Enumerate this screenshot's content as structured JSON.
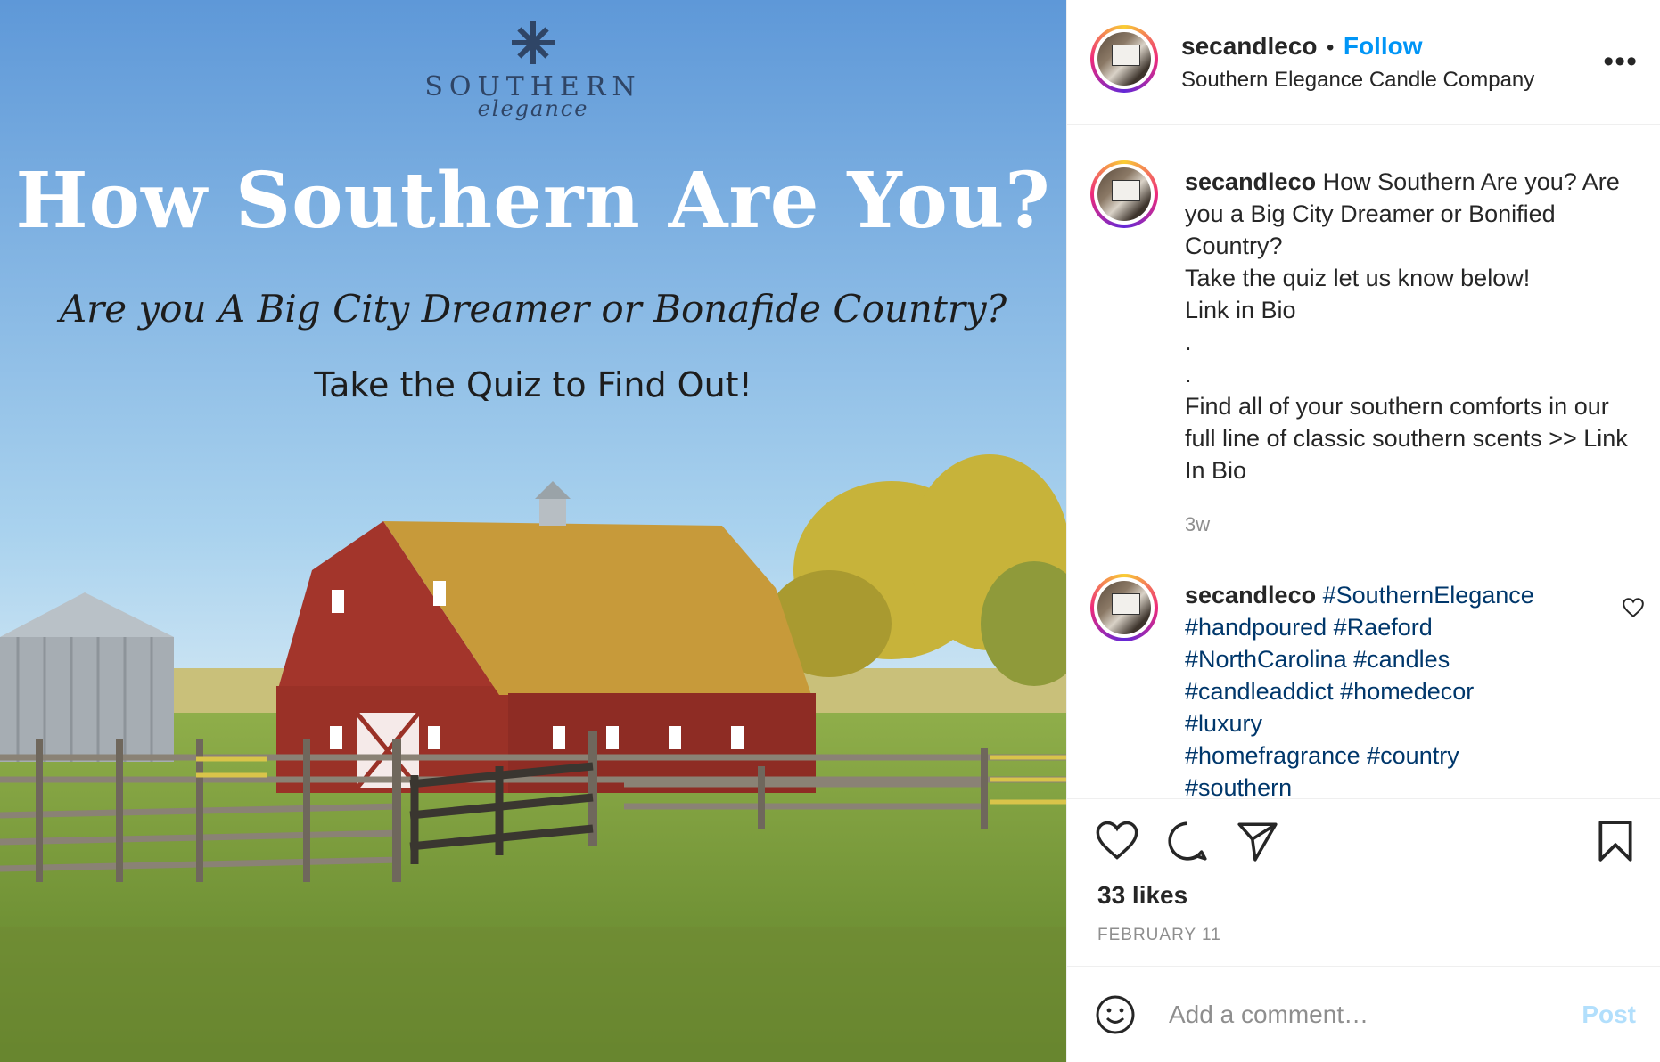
{
  "post_image": {
    "logo_word": "SOUTHERN",
    "logo_script": "elegance",
    "headline": "How Southern Are You?",
    "subhead": "Are you A Big City Dreamer or Bonafide Country?",
    "cta": "Take the Quiz to Find Out!"
  },
  "header": {
    "username": "secandleco",
    "separator": "•",
    "follow_label": "Follow",
    "full_name": "Southern Elegance Candle Company",
    "more_label": "•••"
  },
  "caption": {
    "username": "secandleco",
    "text": " How Southern Are you? Are you a Big City Dreamer or Bonified Country?\nTake the quiz let us know below!\nLink in Bio\n.\n.\nFind all of your southern comforts in our full line of classic southern scents >> Link In Bio",
    "time_ago": "3w"
  },
  "hashtag_comment": {
    "username": "secandleco",
    "tags": [
      "#SouthernElegance",
      "#handpoured",
      "#Raeford",
      "#NorthCarolina",
      "#candles",
      "#candleaddict",
      "#homedecor",
      "#luxury",
      "#homefragrance",
      "#country",
      "#southern"
    ]
  },
  "actions": {
    "like_icon": "heart-icon",
    "comment_icon": "comment-bubble-icon",
    "share_icon": "paper-plane-icon",
    "save_icon": "bookmark-icon"
  },
  "likes": "33 likes",
  "date": "FEBRUARY 11",
  "comment_box": {
    "placeholder": "Add a comment…",
    "post_label": "Post",
    "emoji_icon": "smiley-icon"
  },
  "colors": {
    "follow_blue": "#0095f6",
    "hashtag": "#00376b",
    "post_disabled": "#b2dffc",
    "muted": "#8e8e8e"
  }
}
